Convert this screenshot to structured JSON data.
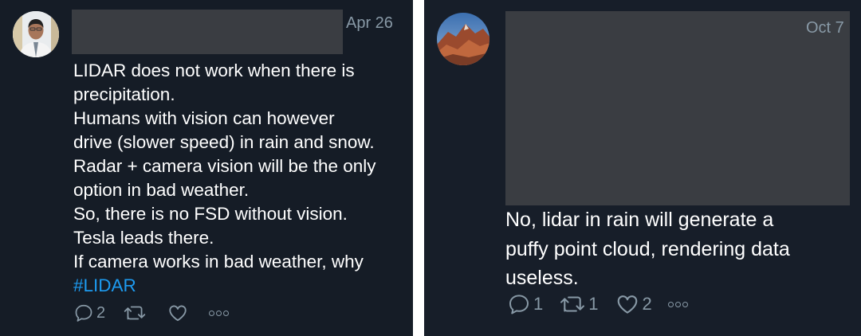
{
  "left_tweet": {
    "date": "Apr 26",
    "text_lines": [
      "LIDAR does not work when there is",
      "precipitation.",
      "Humans with vision can however",
      "drive (slower speed) in rain and snow.",
      "Radar + camera vision will be the only",
      "option in bad weather.",
      "So, there is no FSD without vision.",
      "Tesla leads there.",
      "If camera works in bad weather, why"
    ],
    "hashtag": "#LIDAR",
    "reply_count": "2",
    "retweet_count": "",
    "like_count": "",
    "icons": [
      "reply-icon",
      "retweet-icon",
      "like-icon",
      "more-icon"
    ]
  },
  "right_tweet": {
    "date": "Oct 7",
    "text_lines": [
      "No, lidar in rain will generate a",
      "puffy point cloud, rendering data",
      "useless."
    ],
    "reply_count": "1",
    "retweet_count": "1",
    "like_count": "2",
    "icons": [
      "reply-icon",
      "retweet-icon",
      "like-icon",
      "more-icon"
    ]
  },
  "colors": {
    "background": "#151c26",
    "text": "#ffffff",
    "muted": "#8899a6",
    "hashtag": "#1d9bf0",
    "redaction": "#3a3d42"
  }
}
